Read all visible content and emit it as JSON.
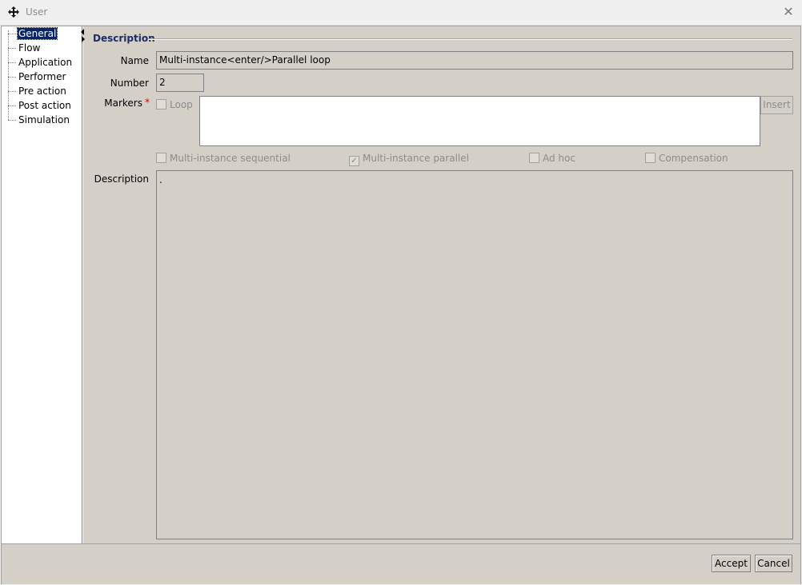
{
  "window": {
    "title": "User"
  },
  "nav": {
    "items": [
      {
        "label": "General",
        "selected": true
      },
      {
        "label": "Flow"
      },
      {
        "label": "Application"
      },
      {
        "label": "Performer"
      },
      {
        "label": "Pre action"
      },
      {
        "label": "Post action"
      },
      {
        "label": "Simulation"
      }
    ]
  },
  "form": {
    "section_title": "Description",
    "name_label": "Name",
    "name_value": "Multi-instance<enter/>Parallel loop",
    "number_label": "Number",
    "number_value": "2",
    "markers_label": "Markers",
    "markers_required": "*",
    "loop_label": "Loop",
    "loop_checked": false,
    "insert_label": "Insert",
    "options": [
      {
        "label": "Multi-instance sequential",
        "checked": false
      },
      {
        "label": "Multi-instance parallel",
        "checked": true
      },
      {
        "label": "Ad hoc",
        "checked": false
      },
      {
        "label": "Compensation",
        "checked": false
      }
    ],
    "description_label": "Description",
    "description_value": "."
  },
  "buttons": {
    "accept_label": "Accept",
    "cancel_label": "Cancel"
  },
  "icons": {
    "app": "move-cross-icon",
    "close": "close-icon"
  }
}
